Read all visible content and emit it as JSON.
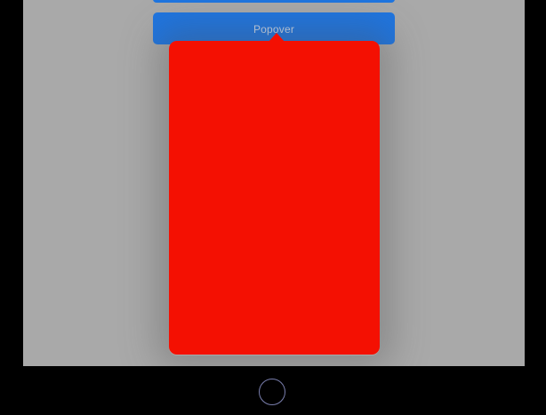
{
  "screen": {
    "background": "#a9a9a9",
    "popover_button": {
      "label": "Popover",
      "color": "#1f75e0"
    },
    "popover": {
      "content_color": "#f41002"
    }
  },
  "device": {
    "frame_color": "#000000",
    "home_button_icon": "home-button-ring"
  }
}
